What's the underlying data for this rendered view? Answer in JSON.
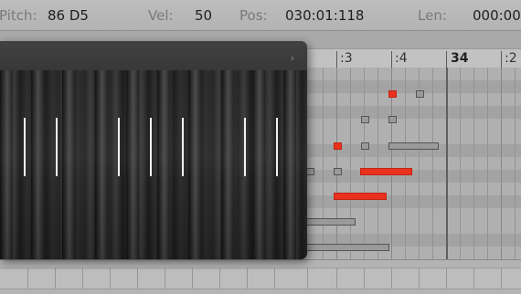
{
  "statusbar": {
    "pitch_label": "Pitch:",
    "pitch_value": "86 D5",
    "vel_label": "Vel:",
    "vel_value": "50",
    "pos_label": "Pos:",
    "pos_value": "030:01:118",
    "len_label": "Len:",
    "len_value": "000:00"
  },
  "ruler": {
    "labels": [
      ":3",
      ":4",
      "34",
      ":2"
    ]
  },
  "overlay": {
    "chevron_icon": "chevron-right-icon"
  },
  "notes": [
    {
      "selected": true
    },
    {
      "selected": false
    },
    {
      "selected": false
    },
    {
      "selected": false
    },
    {
      "selected": true
    },
    {
      "selected": false
    },
    {
      "selected": false
    },
    {
      "selected": false
    },
    {
      "selected": false
    },
    {
      "selected": true
    },
    {
      "selected": true
    },
    {
      "selected": false
    },
    {
      "selected": false
    }
  ],
  "colors": {
    "selected_note": "#e8321e",
    "unselected_note": "#9a9a9a",
    "overlay_bg": "#3a3a3a"
  }
}
